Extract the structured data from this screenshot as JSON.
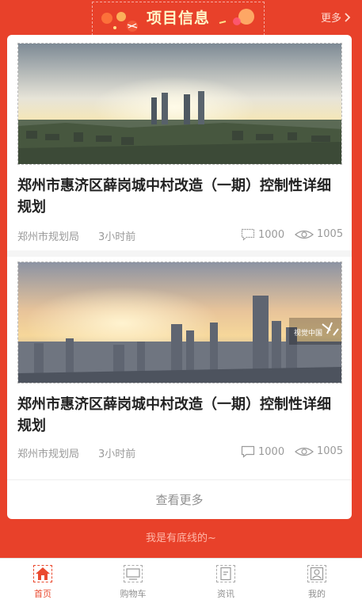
{
  "header": {
    "title": "项目信息",
    "more_label": "更多"
  },
  "articles": [
    {
      "title": "郑州市惠济区薛岗城中村改造（一期）控制性详细规划",
      "source": "郑州市规划局",
      "time": "3小时前",
      "comments": "1000",
      "views": "1005"
    },
    {
      "title": "郑州市惠济区薛岗城中村改造（一期）控制性详细规划",
      "source": "郑州市规划局",
      "time": "3小时前",
      "comments": "1000",
      "views": "1005",
      "image_watermark": "视觉中国"
    }
  ],
  "view_more_label": "查看更多",
  "bottom_line_text": "我是有底线的~",
  "tabbar": {
    "items": [
      {
        "label": "首页",
        "icon": "home-icon",
        "active": true
      },
      {
        "label": "购物车",
        "icon": "cart-icon",
        "active": false
      },
      {
        "label": "资讯",
        "icon": "news-icon",
        "active": false
      },
      {
        "label": "我的",
        "icon": "profile-icon",
        "active": false
      }
    ]
  },
  "colors": {
    "brand_red": "#e8412a",
    "title_yellow": "#fff6c8",
    "active_tab": "#ea4a2f"
  }
}
